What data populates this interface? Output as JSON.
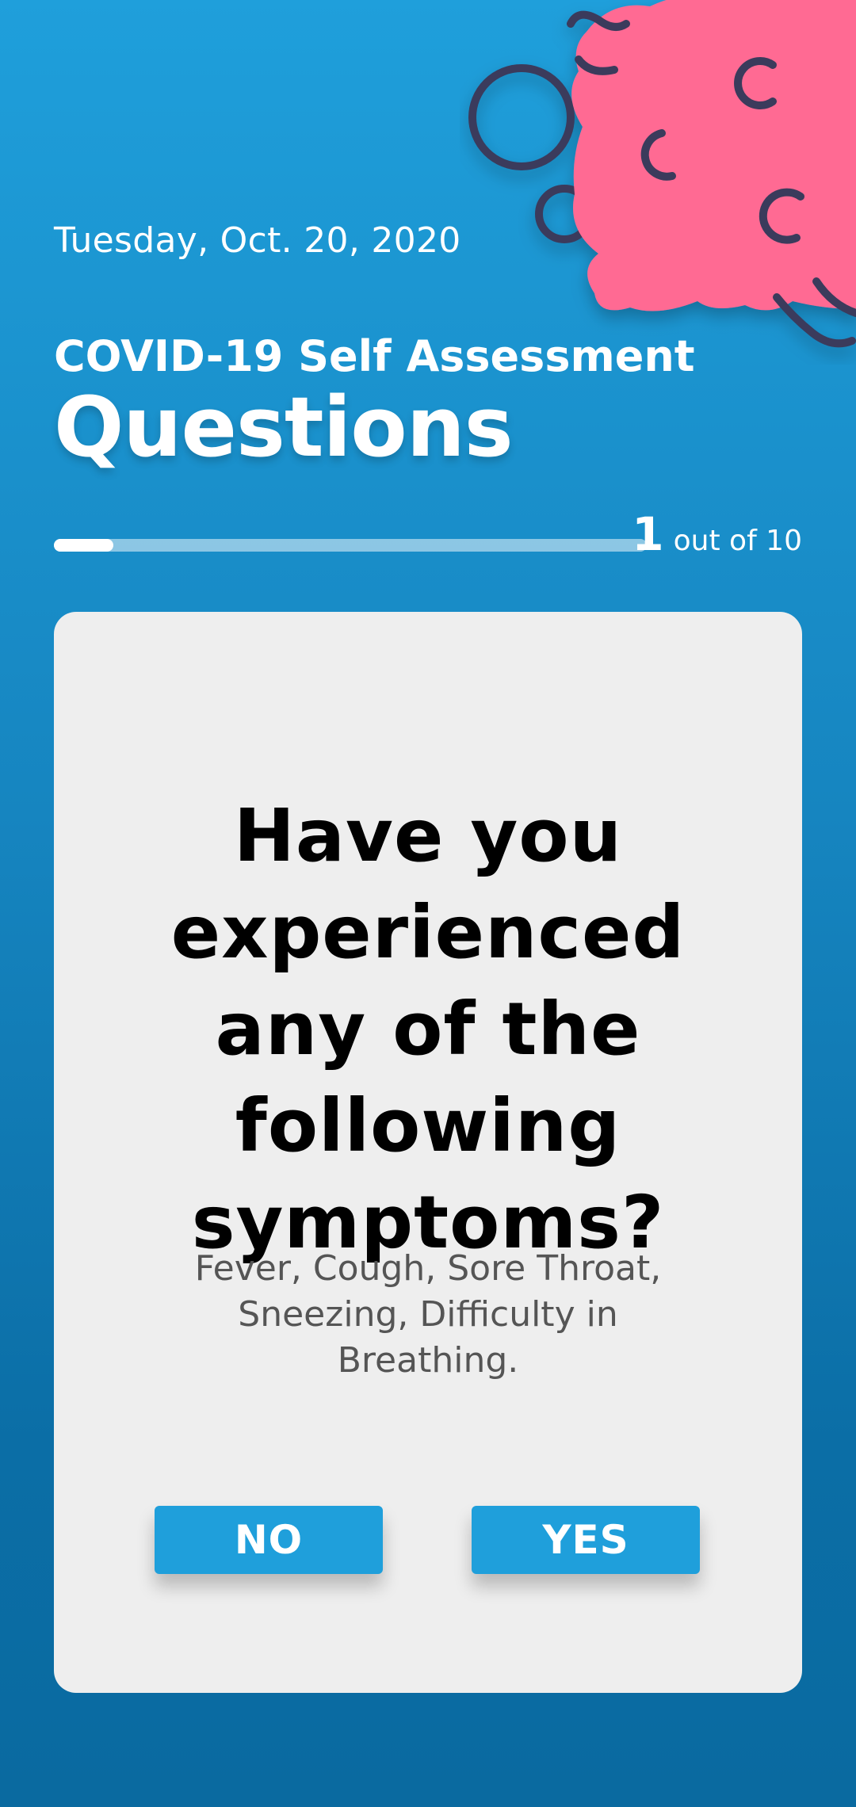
{
  "header": {
    "date": "Tuesday, Oct. 20, 2020",
    "subtitle": "COVID-19 Self Assessment",
    "title": "Questions"
  },
  "progress": {
    "current": "1",
    "total_label": "out of 10",
    "fraction": 0.1
  },
  "question": {
    "text": "Have you experienced any of the following symptoms?",
    "details": "Fever, Cough, Sore Throat, Sneezing, Difficulty in Breathing."
  },
  "buttons": {
    "no_label": "NO",
    "yes_label": "YES"
  },
  "colors": {
    "background_top": "#1f9fdb",
    "background_bottom": "#0a6aa0",
    "card": "#eeeeee",
    "button": "#1f9fdb",
    "virus_body": "#ff6b93",
    "virus_outline": "#3b3a5c"
  },
  "icons": {
    "decoration": "virus-illustration"
  }
}
